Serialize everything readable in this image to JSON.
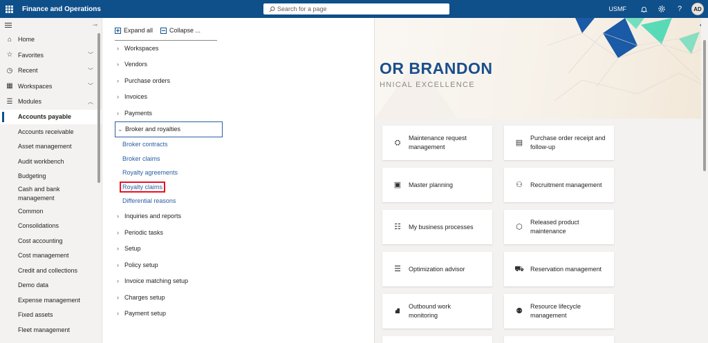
{
  "app": {
    "title": "Finance and Operations",
    "company": "USMF",
    "avatar": "AD"
  },
  "search": {
    "placeholder": "Search for a page"
  },
  "nav": {
    "items": [
      {
        "label": "Home",
        "icon": "home-icon"
      },
      {
        "label": "Favorites",
        "icon": "star-icon"
      },
      {
        "label": "Recent",
        "icon": "clock-icon"
      },
      {
        "label": "Workspaces",
        "icon": "workspaces-icon"
      },
      {
        "label": "Modules",
        "icon": "list-icon"
      }
    ],
    "modules": [
      "Accounts payable",
      "Accounts receivable",
      "Asset management",
      "Audit workbench",
      "Budgeting",
      "Cash and bank management",
      "Common",
      "Consolidations",
      "Cost accounting",
      "Cost management",
      "Credit and collections",
      "Demo data",
      "Expense management",
      "Fixed assets",
      "Fleet management"
    ],
    "selected_module": "Accounts payable"
  },
  "panel": {
    "expand_all": "Expand all",
    "collapse": "Collapse ...",
    "groups": [
      "Workspaces",
      "Vendors",
      "Purchase orders",
      "Invoices",
      "Payments",
      "Broker and royalties",
      "Inquiries and reports",
      "Periodic tasks",
      "Setup",
      "Policy setup",
      "Invoice matching setup",
      "Charges setup",
      "Payment setup"
    ],
    "open_group_children": [
      "Broker contracts",
      "Broker claims",
      "Royalty agreements",
      "Royalty claims",
      "Differential reasons"
    ],
    "highlighted": "Royalty claims"
  },
  "banner": {
    "brand": "OR BRANDON",
    "tagline": "HNICAL EXCELLENCE"
  },
  "tiles": [
    {
      "label": "Maintenance request management",
      "icon": "maintenance-icon"
    },
    {
      "label": "Purchase order receipt and follow-up",
      "icon": "receipt-icon"
    },
    {
      "label": "Master planning",
      "icon": "planning-icon"
    },
    {
      "label": "Recruitment management",
      "icon": "recruitment-icon"
    },
    {
      "label": "My business processes",
      "icon": "process-icon"
    },
    {
      "label": "Released product maintenance",
      "icon": "product-icon"
    },
    {
      "label": "Optimization advisor",
      "icon": "advisor-icon"
    },
    {
      "label": "Reservation management",
      "icon": "reservation-icon"
    },
    {
      "label": "Outbound work monitoring",
      "icon": "outbound-icon"
    },
    {
      "label": "Resource lifecycle management",
      "icon": "lifecycle-icon"
    }
  ]
}
